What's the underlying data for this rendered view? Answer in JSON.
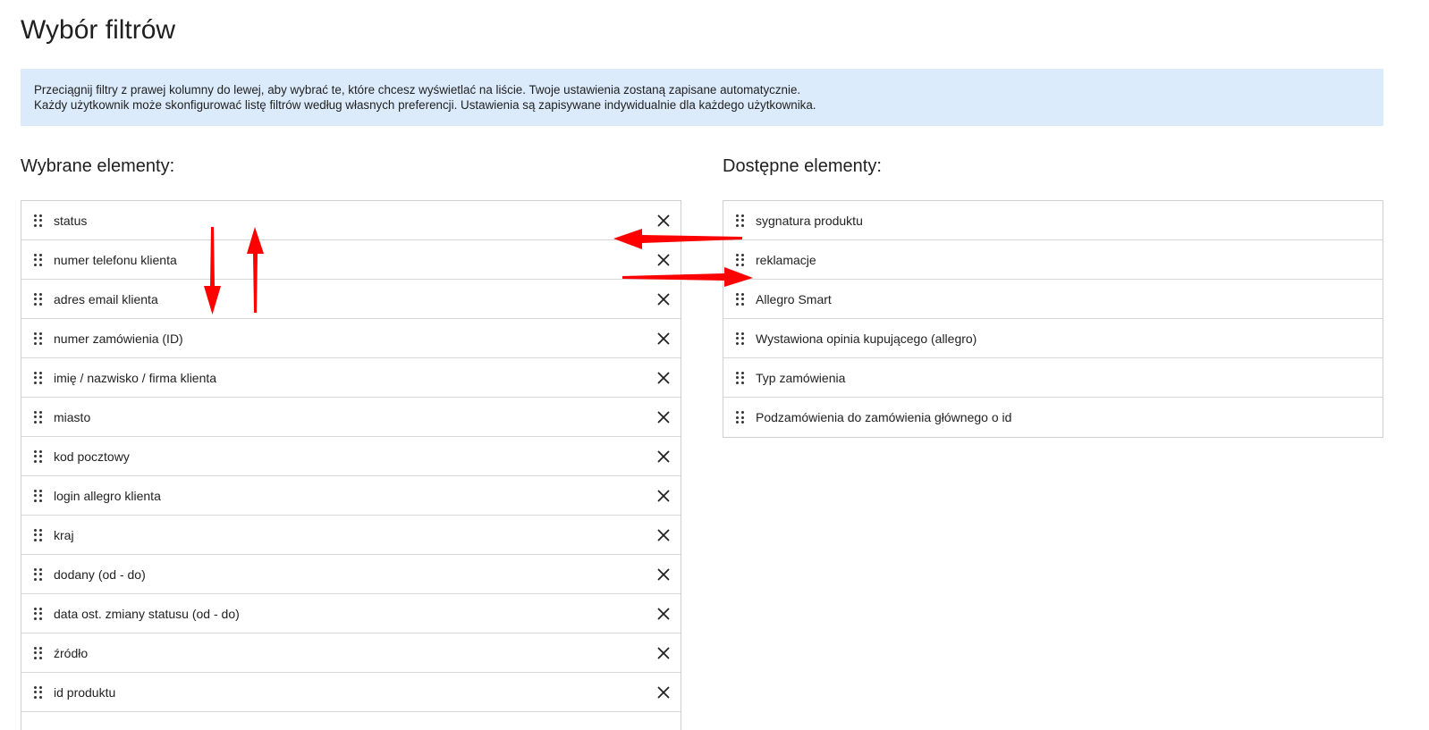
{
  "page": {
    "title": "Wybór filtrów"
  },
  "info": {
    "line1": "Przeciągnij filtry z prawej kolumny do lewej, aby wybrać te, które chcesz wyświetlać na liście. Twoje ustawienia zostaną zapisane automatycznie.",
    "line2": "Każdy użytkownik może skonfigurować listę filtrów według własnych preferencji. Ustawienia są zapisywane indywidualnie dla każdego użytkownika."
  },
  "selected": {
    "heading": "Wybrane elementy:",
    "items": [
      "status",
      "numer telefonu klienta",
      "adres email klienta",
      "numer zamówienia (ID)",
      "imię / nazwisko / firma klienta",
      "miasto",
      "kod pocztowy",
      "login allegro klienta",
      "kraj",
      "dodany (od - do)",
      "data ost. zmiany statusu (od - do)",
      "źródło",
      "id produktu"
    ]
  },
  "available": {
    "heading": "Dostępne elementy:",
    "items": [
      "sygnatura produktu",
      "reklamacje",
      "Allegro Smart",
      "Wystawiona opinia kupującego (allegro)",
      "Typ zamówienia",
      "Podzamówienia do zamówienia głównego o id"
    ]
  },
  "icons": {
    "drag": "drag-handle-icon",
    "remove": "close-icon",
    "annotation": "red-arrow-icon"
  },
  "colors": {
    "info_bg": "#dcebfb",
    "annotation_arrow": "#ff0000",
    "border": "#cfcfcf"
  }
}
